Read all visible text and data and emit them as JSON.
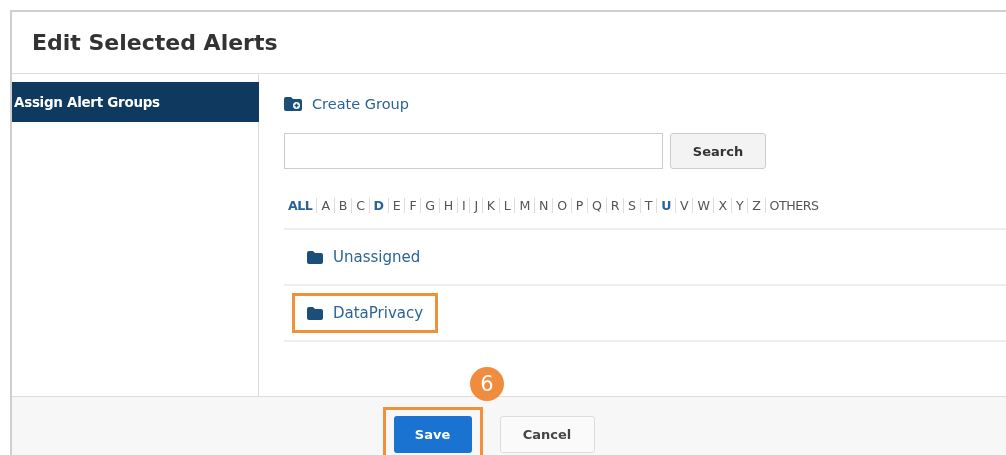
{
  "dialog": {
    "title": "Edit Selected Alerts"
  },
  "sidebar": {
    "items": [
      {
        "label": "Assign Alert Groups",
        "selected": true
      }
    ]
  },
  "create_group": {
    "label": "Create Group"
  },
  "search": {
    "button": "Search"
  },
  "letters": [
    {
      "label": "ALL",
      "highlighted": true
    },
    {
      "label": "A",
      "highlighted": false
    },
    {
      "label": "B",
      "highlighted": false
    },
    {
      "label": "C",
      "highlighted": false
    },
    {
      "label": "D",
      "highlighted": true
    },
    {
      "label": "E",
      "highlighted": false
    },
    {
      "label": "F",
      "highlighted": false
    },
    {
      "label": "G",
      "highlighted": false
    },
    {
      "label": "H",
      "highlighted": false
    },
    {
      "label": "I",
      "highlighted": false
    },
    {
      "label": "J",
      "highlighted": false
    },
    {
      "label": "K",
      "highlighted": false
    },
    {
      "label": "L",
      "highlighted": false
    },
    {
      "label": "M",
      "highlighted": false
    },
    {
      "label": "N",
      "highlighted": false
    },
    {
      "label": "O",
      "highlighted": false
    },
    {
      "label": "P",
      "highlighted": false
    },
    {
      "label": "Q",
      "highlighted": false
    },
    {
      "label": "R",
      "highlighted": false
    },
    {
      "label": "S",
      "highlighted": false
    },
    {
      "label": "T",
      "highlighted": false
    },
    {
      "label": "U",
      "highlighted": true
    },
    {
      "label": "V",
      "highlighted": false
    },
    {
      "label": "W",
      "highlighted": false
    },
    {
      "label": "X",
      "highlighted": false
    },
    {
      "label": "Y",
      "highlighted": false
    },
    {
      "label": "Z",
      "highlighted": false
    },
    {
      "label": "OTHERS",
      "highlighted": false
    }
  ],
  "groups": [
    {
      "name": "Unassigned",
      "annotated": false
    },
    {
      "name": "DataPrivacy",
      "annotated": true
    }
  ],
  "step_badge": "6",
  "footer": {
    "buttons": [
      {
        "label": "Save",
        "kind": "primary",
        "annotated": true
      },
      {
        "label": "Cancel",
        "kind": "secondary",
        "annotated": false
      }
    ]
  }
}
